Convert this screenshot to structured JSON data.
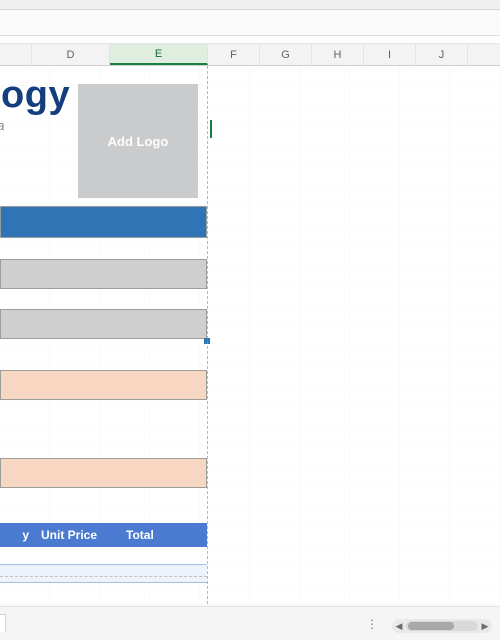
{
  "columns": {
    "D": "D",
    "E": "E",
    "F": "F",
    "G": "G",
    "H": "H",
    "I": "I",
    "J": "J"
  },
  "active_column": "E",
  "document": {
    "title_fragment": "logy",
    "subtitle_fragment": "ria"
  },
  "logo": {
    "placeholder": "Add Logo"
  },
  "invoice_table": {
    "qty_header_fragment": "y",
    "unit_price_header": "Unit Price",
    "total_header": "Total"
  },
  "scroll": {
    "left_glyph": "◀",
    "right_glyph": "▶"
  },
  "tab_options_glyph": "⋮"
}
